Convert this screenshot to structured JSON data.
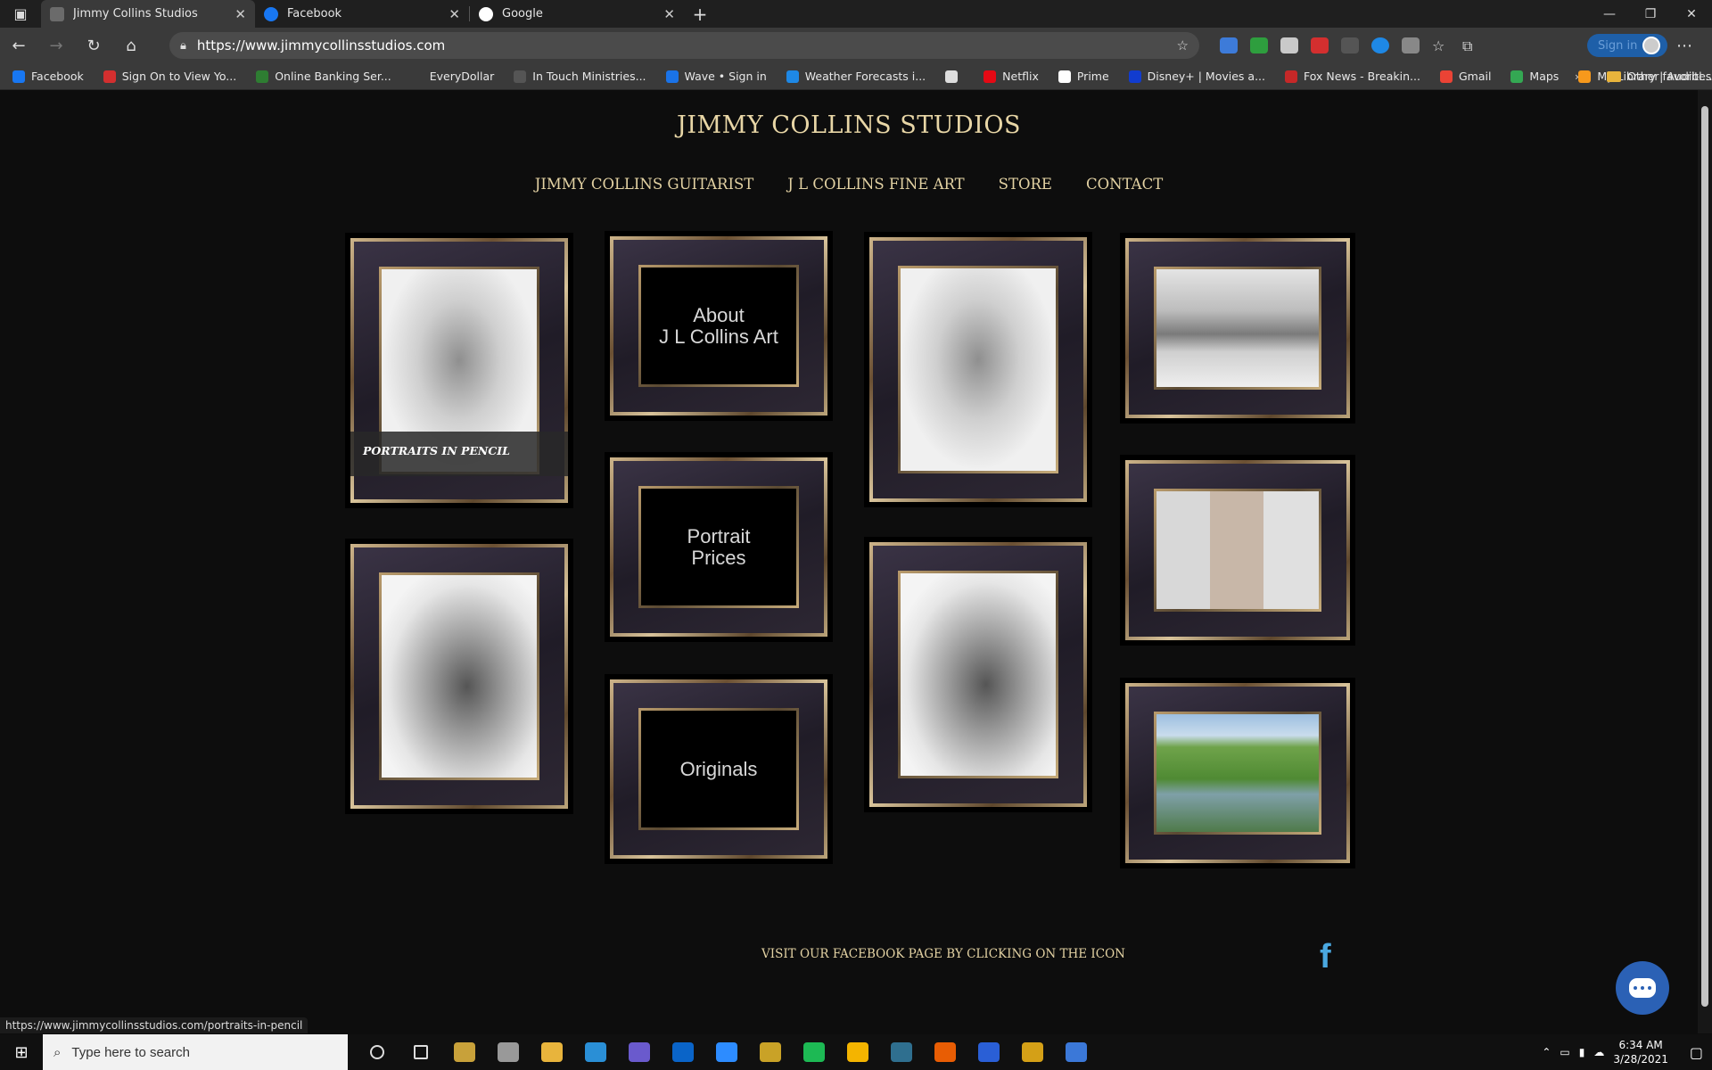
{
  "browser": {
    "tabs": [
      {
        "title": "Jimmy Collins Studios",
        "favicon_color": "#6b6b6b",
        "active": true
      },
      {
        "title": "Facebook",
        "favicon_color": "#1877f2",
        "active": false
      },
      {
        "title": "Google",
        "favicon_color": "#ffffff",
        "active": false
      }
    ],
    "url": "https://www.jimmycollinsstudios.com",
    "signin_label": "Sign in",
    "favorites": [
      {
        "label": "Facebook",
        "color": "#1877f2"
      },
      {
        "label": "Sign On to View Yo...",
        "color": "#d32f2f"
      },
      {
        "label": "Online Banking Ser...",
        "color": "#2e7d32"
      },
      {
        "label": "EveryDollar",
        "color": "#3a3a3a"
      },
      {
        "label": "In Touch Ministries...",
        "color": "#555555"
      },
      {
        "label": "Wave • Sign in",
        "color": "#1a73e8"
      },
      {
        "label": "Weather Forecasts i...",
        "color": "#1e88e5"
      },
      {
        "label": "",
        "color": "#dddddd"
      },
      {
        "label": "Netflix",
        "color": "#e50914"
      },
      {
        "label": "Prime",
        "color": "#ffffff"
      },
      {
        "label": "Disney+ | Movies a...",
        "color": "#113ccf"
      },
      {
        "label": "Fox News - Breakin...",
        "color": "#c62828"
      },
      {
        "label": "Gmail",
        "color": "#ea4335"
      },
      {
        "label": "Maps",
        "color": "#34a853"
      },
      {
        "label": "My Library | Audibl...",
        "color": "#f7991c"
      }
    ],
    "other_favorites": "Other favorites",
    "status_url": "https://www.jimmycollinsstudios.com/portraits-in-pencil"
  },
  "site": {
    "title": "JIMMY COLLINS STUDIOS",
    "menu": [
      "JIMMY COLLINS GUITARIST",
      "J L COLLINS FINE ART",
      "STORE",
      "CONTACT"
    ],
    "tiles": {
      "about": "About\nJ L  Collins Art",
      "prices": "Portrait\nPrices",
      "originals": "Originals",
      "portraits_caption": "PORTRAITS IN PENCIL"
    },
    "footer_text": "VISIT OUR FACEBOOK PAGE BY CLICKING ON THE ICON",
    "facebook_icon": "f"
  },
  "taskbar": {
    "search_placeholder": "Type here to search",
    "time": "6:34 AM",
    "date": "3/28/2021",
    "apps": [
      "cortana-icon",
      "task-view-icon",
      "store-icon",
      "app-icon",
      "file-explorer-icon",
      "edge-icon",
      "app-icon",
      "outlook-icon",
      "zoom-icon",
      "app-icon",
      "app-icon",
      "chrome-icon",
      "app-icon",
      "app-icon",
      "headphones-icon",
      "app-icon",
      "photos-icon"
    ],
    "app_colors": [
      "#bbbbbb",
      "#bbbbbb",
      "#c8a13a",
      "#999999",
      "#e8b43c",
      "#2a8fd6",
      "#6a5acd",
      "#0a64c8",
      "#2d8cff",
      "#c9a227",
      "#1db954",
      "#f4b400",
      "#2f6f8f",
      "#e85d04",
      "#2a5fd6",
      "#d4a017",
      "#3b78d8"
    ]
  }
}
